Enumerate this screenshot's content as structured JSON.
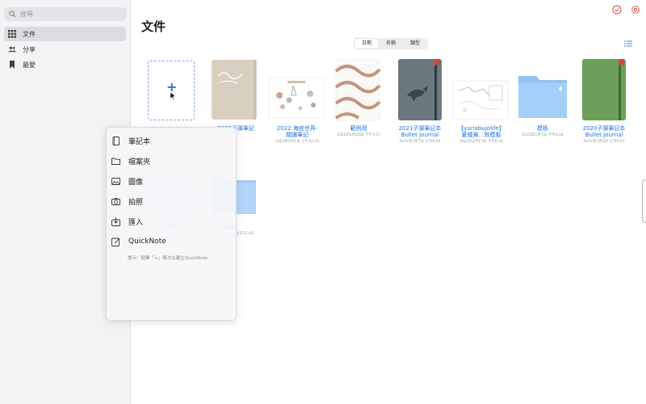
{
  "sidebar": {
    "search_placeholder": "搜尋",
    "items": [
      {
        "label": "文件",
        "icon": "grid-icon",
        "active": true
      },
      {
        "label": "分享",
        "icon": "people-icon",
        "active": false
      },
      {
        "label": "最愛",
        "icon": "bookmark-icon",
        "active": false
      }
    ]
  },
  "header": {
    "title": "文件",
    "sort_options": [
      "日期",
      "名稱",
      "類型"
    ],
    "sort_selected": "日期",
    "top_icons": [
      "checkmark-circle-icon",
      "gear-icon"
    ],
    "view_icon": "list-view-icon"
  },
  "documents": [
    {
      "title": "2022子彈筆記",
      "date": "",
      "cover": "beige-notebook"
    },
    {
      "title": "2022 海底世界-\n閱讀筆記",
      "date": "2022年5月1日 上午10:34",
      "cover": "ocean-sketch"
    },
    {
      "title": "範例用",
      "date": "2022年4月26日 下午3:57",
      "cover": "wavy-lines"
    },
    {
      "title": "2021子彈筆記本\nBullet Journal",
      "date": "2022年3月7日 上午8:44",
      "cover": "whale-notebook"
    },
    {
      "title": "【yuriabujolife】\n夏威夷…效模板",
      "date": "2022年2月17日 下午6:30",
      "cover": "map-sketch"
    },
    {
      "title": "模板",
      "date": "2022年1月7日 下午4:34",
      "cover": "folder"
    },
    {
      "title": "2020子彈筆記本\nBullet Journal",
      "date": "2022年1月3日 上午9:03",
      "cover": "green-notebook"
    }
  ],
  "ghost_items": [
    {
      "title": "2021",
      "date": ""
    },
    {
      "title": "模板",
      "date": "上午11:42"
    }
  ],
  "new_menu": {
    "items": [
      {
        "label": "筆記本",
        "icon": "notebook-icon"
      },
      {
        "label": "檔案夾",
        "icon": "folder-icon"
      },
      {
        "label": "圖像",
        "icon": "image-icon"
      },
      {
        "label": "拍照",
        "icon": "camera-icon"
      },
      {
        "label": "匯入",
        "icon": "import-icon"
      },
      {
        "label": "QuickNote",
        "icon": "quicknote-icon"
      }
    ],
    "hint": "提示：點擊「+」兩次以建立QuickNote"
  },
  "colors": {
    "accent": "#1a73e8",
    "sidebar_bg": "#f3f3f5",
    "folder_blue": "#8fc2f5",
    "notebook_green": "#6aa05a",
    "notebook_gray": "#6c7880",
    "bookmark_red": "#d9443a"
  }
}
